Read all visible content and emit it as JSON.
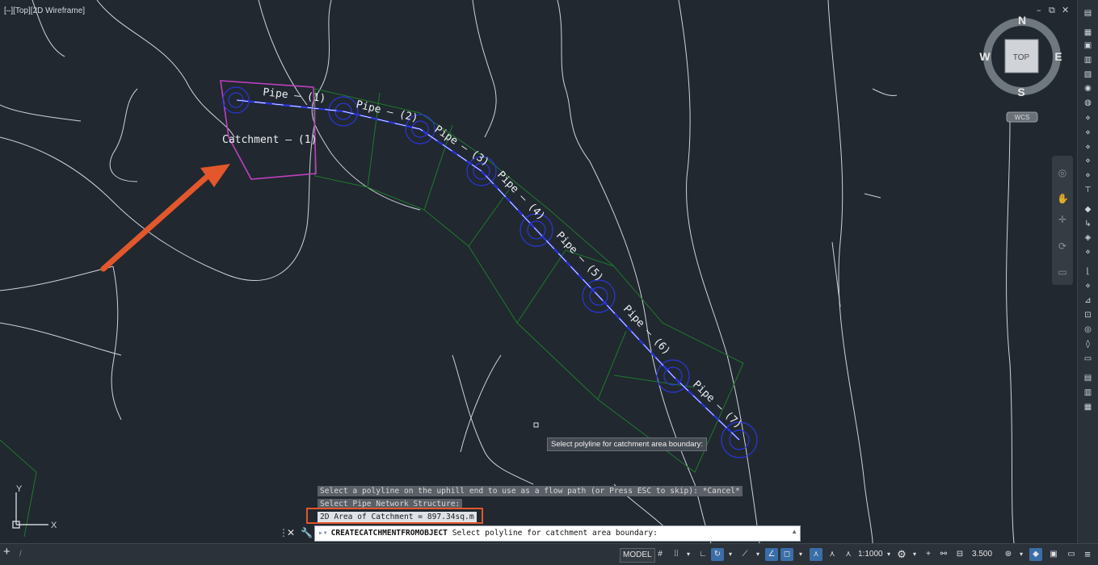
{
  "viewport": {
    "label": "[–][Top][2D Wireframe]",
    "window_controls": [
      "–",
      "⧉",
      "✕"
    ]
  },
  "viewcube": {
    "north": "N",
    "south": "S",
    "east": "E",
    "west": "W",
    "face": "TOP",
    "ucs": "WCS"
  },
  "drawing": {
    "catchment_label": "Catchment – (1)",
    "pipe_labels": [
      "Pipe – (1)",
      "Pipe – (2)",
      "Pipe – (3)",
      "Pipe – (4)",
      "Pipe – (5)",
      "Pipe – (6)",
      "Pipe – (7)"
    ],
    "ucs_x": "X",
    "ucs_y": "Y",
    "colors": {
      "pipe": "#2a36d8",
      "catchment": "#c040c0",
      "parcel": "#1e7a2a",
      "contour": "#cfd3d8",
      "arrow": "#e2572b",
      "highlight_box": "#e0572b"
    }
  },
  "tooltip": "Select polyline for catchment area boundary:",
  "command_history": [
    "Select a polyline on the uphill end to use as a flow path (or Press ESC to skip): *Cancel*",
    "Select Pipe Network Structure:",
    "2D Area of Catchment = 897.34sq.m"
  ],
  "command_line": {
    "command": "CREATECATCHMENTFROMOBJECT",
    "prompt": "Select polyline for catchment area boundary:"
  },
  "statusbar": {
    "model": "MODEL",
    "scale": "1:1000",
    "lineweight": "3.500"
  },
  "icons": {
    "add_layout": "plus-icon",
    "grid": "grid-icon",
    "snap": "snap-icon",
    "ortho": "ortho-icon",
    "polar": "polar-icon",
    "osnap": "osnap-icon",
    "gear": "gear-icon",
    "menu": "hamburger-icon"
  }
}
